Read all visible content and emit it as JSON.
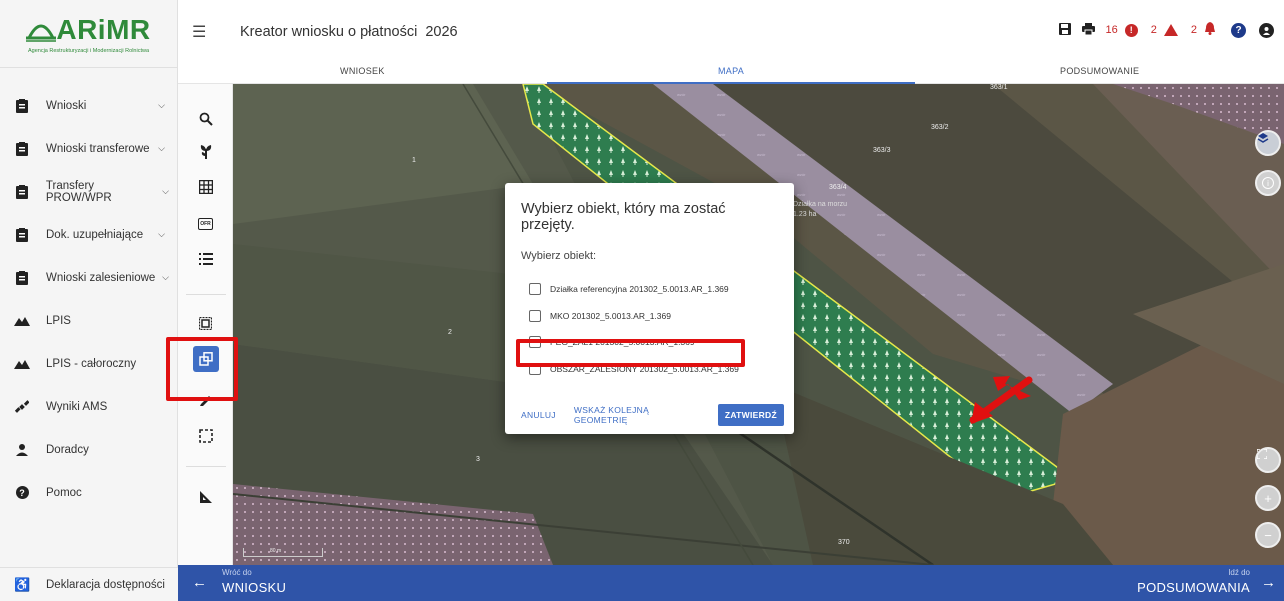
{
  "logo": {
    "name": "ARiMR",
    "subtitle": "Agencja Restrukturyzacji i Modernizacji Rolnictwa"
  },
  "sidebar": {
    "items": [
      {
        "label": "Wnioski",
        "icon": "document-icon",
        "expandable": true
      },
      {
        "label": "Wnioski transferowe",
        "icon": "document-icon",
        "expandable": true
      },
      {
        "label": "Transfery PROW/WPR",
        "icon": "document-icon",
        "expandable": true
      },
      {
        "label": "Dok. uzupełniające",
        "icon": "document-icon",
        "expandable": true
      },
      {
        "label": "Wnioski zalesieniowe",
        "icon": "document-icon",
        "expandable": true
      },
      {
        "label": "LPIS",
        "icon": "terrain-icon",
        "expandable": false
      },
      {
        "label": "LPIS - całoroczny",
        "icon": "terrain-icon",
        "expandable": false
      },
      {
        "label": "Wyniki AMS",
        "icon": "satellite-icon",
        "expandable": false
      },
      {
        "label": "Doradcy",
        "icon": "person-icon",
        "expandable": false
      },
      {
        "label": "Pomoc",
        "icon": "help-icon",
        "expandable": false
      }
    ],
    "footer": {
      "label": "Deklaracja dostępności",
      "icon": "accessibility-icon"
    }
  },
  "header": {
    "title": "Kreator wniosku o płatności",
    "year": "2026",
    "counters": {
      "errors": "16",
      "warnings": "2",
      "alerts": "2"
    }
  },
  "tabs": [
    {
      "label": "WNIOSEK",
      "active": false
    },
    {
      "label": "MAPA",
      "active": true
    },
    {
      "label": "PODSUMOWANIE",
      "active": false
    }
  ],
  "map": {
    "parcel_labels": [
      "1",
      "2",
      "3",
      "363/1",
      "363/2",
      "363/3",
      "363/4",
      "370"
    ],
    "info_label": "Działka na morzu",
    "info_area": "1.23 ha",
    "scale_label": "80 m"
  },
  "dialog": {
    "title": "Wybierz obiekt, który ma zostać przejęty.",
    "subtitle": "Wybierz obiekt:",
    "options": [
      {
        "label": "Działka referencyjna 201302_5.0013.AR_1.369",
        "checked": false
      },
      {
        "label": "MKO 201302_5.0013.AR_1.369",
        "checked": false
      },
      {
        "label": "PEG_ZAL1 201302_5.0013.AR_1.369",
        "checked": false
      },
      {
        "label": "OBSZAR_ZALESIONY 201302_5.0013.AR_1.369",
        "checked": false
      }
    ],
    "cancel_label": "ANULUJ",
    "next_label": "WSKAŻ KOLEJNĄ GEOMETRIĘ",
    "confirm_label": "ZATWIERDŹ"
  },
  "footer_nav": {
    "back_small": "Wróć do",
    "back_main": "WNIOSKU",
    "forward_small": "Idź do",
    "forward_main": "PODSUMOWANIA"
  },
  "colors": {
    "brand_green": "#2f8a3a",
    "primary_blue": "#3f6ec5",
    "nav_bar": "#2f54a8",
    "highlight_red": "#e01010",
    "forest_green": "#2e7d4f"
  }
}
